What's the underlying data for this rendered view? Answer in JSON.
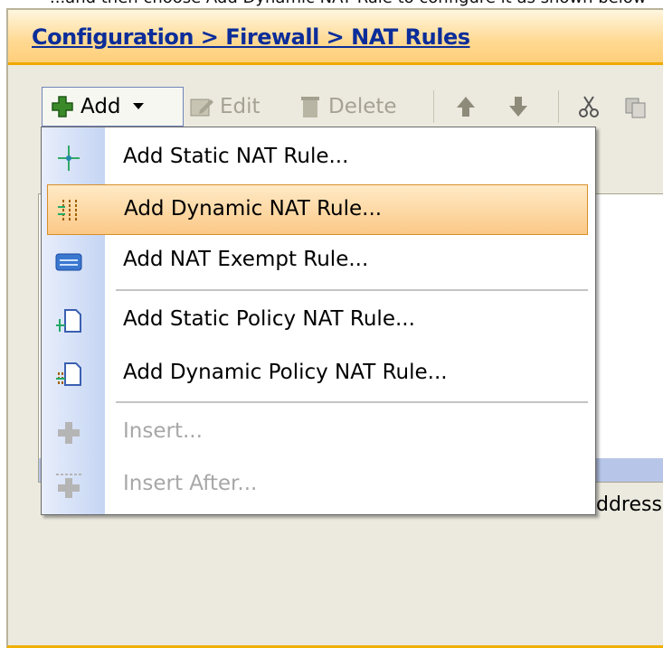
{
  "top_caption": "...and then choose Add Dynamic NAT Rule to configure it as shown below",
  "breadcrumb": "Configuration > Firewall > NAT Rules",
  "toolbar": {
    "add": "Add",
    "edit": "Edit",
    "delete": "Delete"
  },
  "menu": {
    "items": [
      {
        "label": "Add Static NAT Rule...",
        "icon": "static-nat-icon"
      },
      {
        "label": "Add Dynamic NAT Rule...",
        "icon": "dynamic-nat-icon",
        "highlighted": true
      },
      {
        "label": "Add NAT Exempt Rule...",
        "icon": "nat-exempt-icon"
      },
      {
        "label": "Add Static Policy NAT Rule...",
        "icon": "static-policy-nat-icon"
      },
      {
        "label": "Add Dynamic Policy NAT Rule...",
        "icon": "dynamic-policy-nat-icon"
      },
      {
        "label": "Insert...",
        "icon": "insert-icon",
        "disabled": true
      },
      {
        "label": "Insert After...",
        "icon": "insert-after-icon",
        "disabled": true
      }
    ]
  },
  "background_text": "ddress",
  "colors": {
    "header_accent": "#f0a800",
    "link": "#0b2d9a",
    "highlight": "#fbc987"
  }
}
